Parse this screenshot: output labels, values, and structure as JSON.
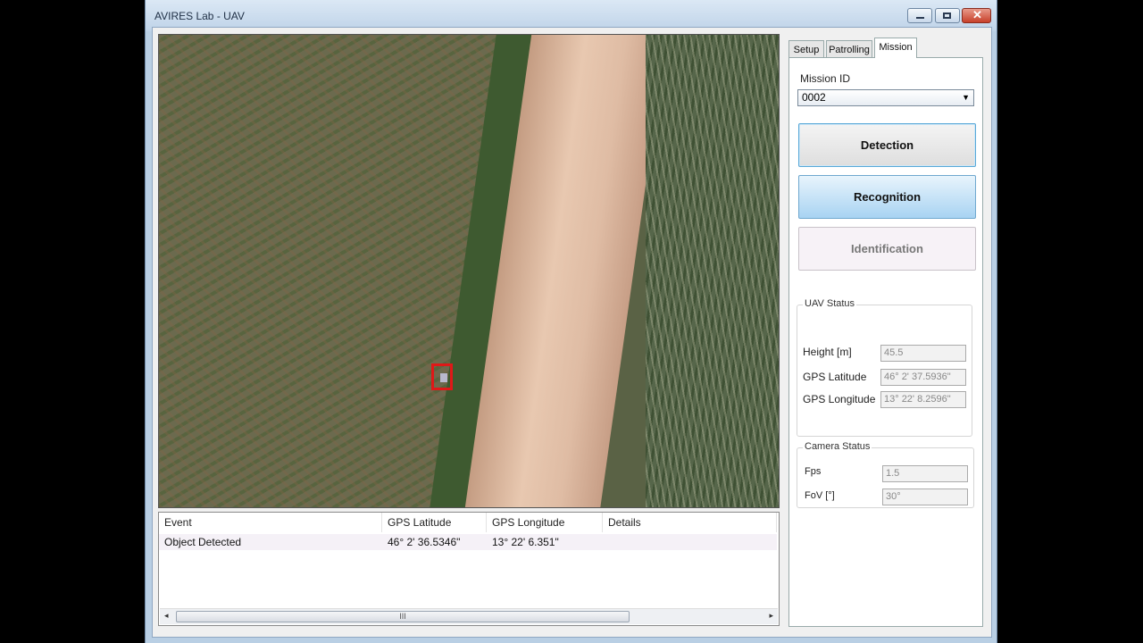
{
  "window": {
    "title": "AVIRES Lab - UAV"
  },
  "tabs": [
    {
      "label": "Setup"
    },
    {
      "label": "Patrolling"
    },
    {
      "label": "Mission"
    }
  ],
  "mission": {
    "id_label": "Mission ID",
    "id_value": "0002",
    "buttons": {
      "detection": "Detection",
      "recognition": "Recognition",
      "identification": "Identification"
    }
  },
  "uav_status": {
    "title": "UAV Status",
    "height_label": "Height [m]",
    "height_value": "45.5",
    "lat_label": "GPS Latitude",
    "lat_value": "46° 2' 37.5936\"",
    "lon_label": "GPS Longitude",
    "lon_value": "13° 22' 8.2596\""
  },
  "camera_status": {
    "title": "Camera Status",
    "fps_label": "Fps",
    "fps_value": "1.5",
    "fov_label": "FoV [°]",
    "fov_value": "30°"
  },
  "events": {
    "columns": [
      "Event",
      "GPS Latitude",
      "GPS Longitude",
      "Details"
    ],
    "rows": [
      {
        "event": "Object Detected",
        "lat": "46° 2' 36.5346\"",
        "lon": "13° 22' 6.351\"",
        "details": ""
      }
    ]
  },
  "scroll": {
    "grip": "III",
    "left": "◂",
    "right": "▸"
  },
  "icons": {
    "minimize": "minimize-icon",
    "maximize": "maximize-icon",
    "close": "close-icon",
    "dropdown": "chevron-down-icon"
  }
}
